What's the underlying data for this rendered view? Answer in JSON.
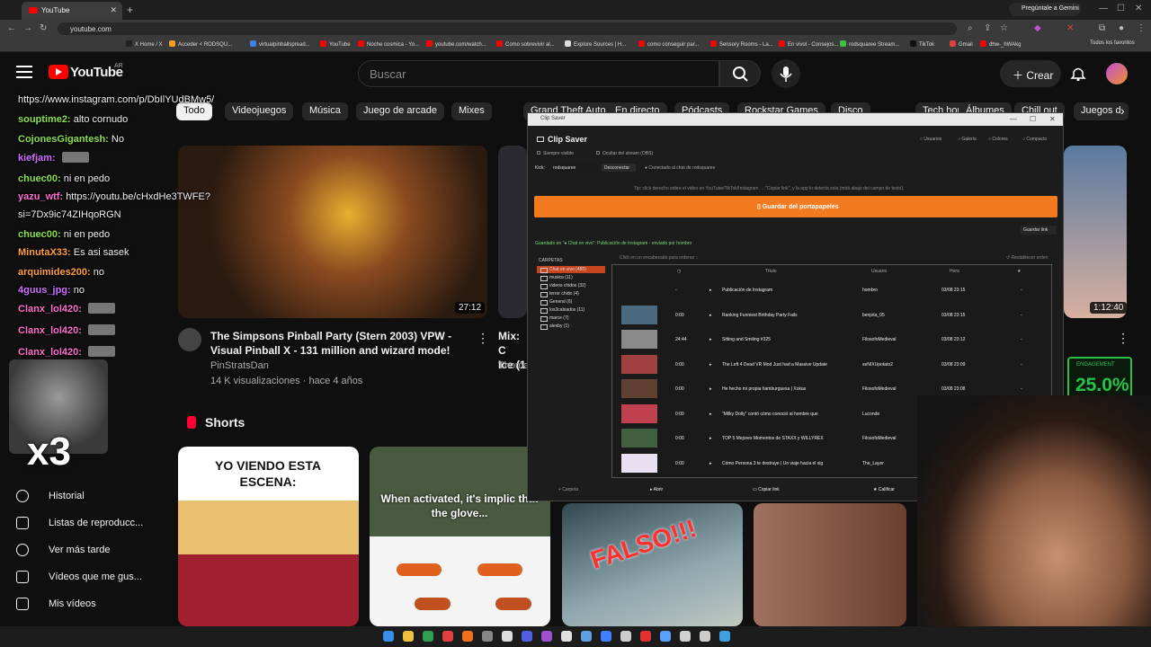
{
  "browser": {
    "tab_title": "YouTube",
    "url": "youtube.com",
    "gemini_label": "Pregúntale a Gemini",
    "all_bookmarks": "Todos los favoritos",
    "bookmarks": [
      "X Home / X",
      "Acceder < RODSQU...",
      "virtualpinballspread...",
      "YouTube",
      "Noche cosmica - Yo...",
      "youtube.com/watch...",
      "Como sobrevivir al...",
      "Explore Sources | H...",
      "como conseguir par...",
      "Sensory Rooms - La...",
      "En vivol - Consejos...",
      "rodsquaree Stream...",
      "TikTok",
      "Gmail",
      "dhw-_hWAkg"
    ]
  },
  "youtube": {
    "logo_text": "YouTube",
    "region": "AR",
    "search_placeholder": "Buscar",
    "create_label": "Crear",
    "chips": [
      "Todo",
      "Videojuegos",
      "Música",
      "Juego de arcade",
      "Mixes",
      "Grand Theft Auto IV",
      "En directo",
      "Pódcasts",
      "Rockstar Games",
      "Disco",
      "Tech house",
      "Álbumes",
      "Chill out",
      "Juegos d"
    ],
    "video1": {
      "duration": "27:12",
      "title_line1": "The Simpsons Pinball Party (Stern 2003) VPW -",
      "title_line2": "Visual Pinball X - 131 million  and wizard mode!",
      "channel": "PinStratsDan",
      "meta": "14 K visualizaciones · hace 4 años"
    },
    "video2": {
      "title_line1": "Mix: C",
      "title_line2": "Ice (1",
      "channel": "Thoma"
    },
    "video3": {
      "duration": "1:12:40"
    },
    "shorts_title": "Shorts",
    "shorts": [
      {
        "caption": "YO VIENDO ESTA ESCENA:"
      },
      {
        "caption": "When activated, it's implic that the glove..."
      },
      {
        "caption": "FALSO!!!"
      },
      {
        "caption": ""
      }
    ],
    "sidebar": [
      "Historial",
      "Listas de reproducc...",
      "Ver más tarde",
      "Vídeos que me gus...",
      "Mis vídeos"
    ]
  },
  "chat": {
    "url_line": "https://www.instagram.com/p/DbIlYUdBMw5/",
    "messages": [
      {
        "user": "souptime2:",
        "text": "alto cornudo",
        "color": "#8be04e"
      },
      {
        "user": "CojonesGigantesh:",
        "text": "No",
        "color": "#8be04e"
      },
      {
        "user": "kiefjam:",
        "text": "",
        "color": "#d070ff",
        "emote": true
      },
      {
        "user": "chuec00:",
        "text": "ni en pedo",
        "color": "#8be04e"
      },
      {
        "user": "yazu_wtf:",
        "text": "https://youtu.be/cHxdHe3TWFE?",
        "color": "#ff6fd0"
      },
      {
        "user": "",
        "text": "si=7Dx9ic74ZIHqoRGN",
        "color": "#ffffff"
      },
      {
        "user": "chuec00:",
        "text": "ni en pedo",
        "color": "#8be04e"
      },
      {
        "user": "MinutaX33:",
        "text": "Es asi sasek",
        "color": "#ff9f3f"
      },
      {
        "user": "arquimides200:",
        "text": "no",
        "color": "#ff9f3f"
      },
      {
        "user": "4guus_jpg:",
        "text": "no",
        "color": "#d070ff"
      },
      {
        "user": "Clanx_lol420:",
        "text": "",
        "color": "#ff6fd0",
        "emote": true
      },
      {
        "user": "Clanx_lol420:",
        "text": "",
        "color": "#ff6fd0",
        "emote": true
      },
      {
        "user": "Clanx_lol420:",
        "text": "",
        "color": "#ff6fd0",
        "emote": true
      }
    ],
    "multiplier": "x3"
  },
  "clipsaver": {
    "window_title": "Clip Saver",
    "title": "Clip Saver",
    "nav": [
      "Usuarios",
      "Galería",
      "Colores",
      "Compacto"
    ],
    "always_visible": "Siempre visible",
    "hide_stream": "Ocultar del stream (OBS)",
    "kick_label": "Kick:",
    "kick_user": "rodsquaree",
    "disconnect": "Desconectar",
    "connected": "Conectado al chat de rodsquaree",
    "tip": "Tip: click derecho sobre el video en YouTube/TikTok/Instagram → \"Copiar link\", y la app lo detecta sola (mirá abajo del campo de texto).",
    "save_button": "Guardar del portapapeles",
    "save_link": "Guardar link",
    "status": "Guardado en \"● Chat en vivo\": Publicación de Instagram - enviado por hombro",
    "sort_hint": "Click en un encabezado para ordenar ↕",
    "restore_order": "↺ Restablecer orden",
    "folders_label": "CARPETAS",
    "folders": [
      "Chat en vivo  (480)",
      "musica  (11)",
      "videos chidos  (32)",
      "terror chido  (4)",
      "General  (6)",
      "los3cabiados  (11)",
      "marce  (7)",
      "alexby  (1)"
    ],
    "headers": [
      "Título",
      "Usuario",
      "Hora"
    ],
    "rows": [
      {
        "dur": "-",
        "title": "Publicación de Instagram",
        "user": "hombro",
        "time": "03/08 23:15",
        "star": "-"
      },
      {
        "dur": "0:00",
        "title": "Ranking Funniest Birthday Party Fails",
        "user": "benjota_05",
        "time": "03/08 23:15",
        "star": "-"
      },
      {
        "dur": "24:44",
        "title": "Sitting and Smiling #325",
        "user": "FilosofoMedieval",
        "time": "03/08 23:12",
        "star": "-"
      },
      {
        "dur": "0:00",
        "title": "The Left 4 Dead VR Mod Just had a Massive Update",
        "user": "seNIXUpotato2",
        "time": "03/08 23:09",
        "star": "-"
      },
      {
        "dur": "0:00",
        "title": "He hecho mi propia hamburguesa | Xokas",
        "user": "FilosofoMedieval",
        "time": "03/08 23:08",
        "star": "-"
      },
      {
        "dur": "0:00",
        "title": "\"Milky Dolly\" contó cómo conoció al hombre que",
        "user": "Luconde",
        "time": "03/08 23:0",
        "star": ""
      },
      {
        "dur": "0:00",
        "title": "TOP 5 Mejores Momentos de STAXX y WILLYREX",
        "user": "FilosofoMedieval",
        "time": "",
        "star": ""
      },
      {
        "dur": "0:00",
        "title": "Cómo Persona 3 te destruye | Un viaje hacia el sig",
        "user": "The_Layer",
        "time": "",
        "star": ""
      }
    ],
    "bottom": {
      "folder": "+ Carpeta",
      "open": "Abrir",
      "copy": "Copiar link",
      "rate": "Calificar"
    }
  },
  "engagement": {
    "label": "ENGAGEMENT",
    "value": "25.0%",
    "color": "#26c24a"
  }
}
